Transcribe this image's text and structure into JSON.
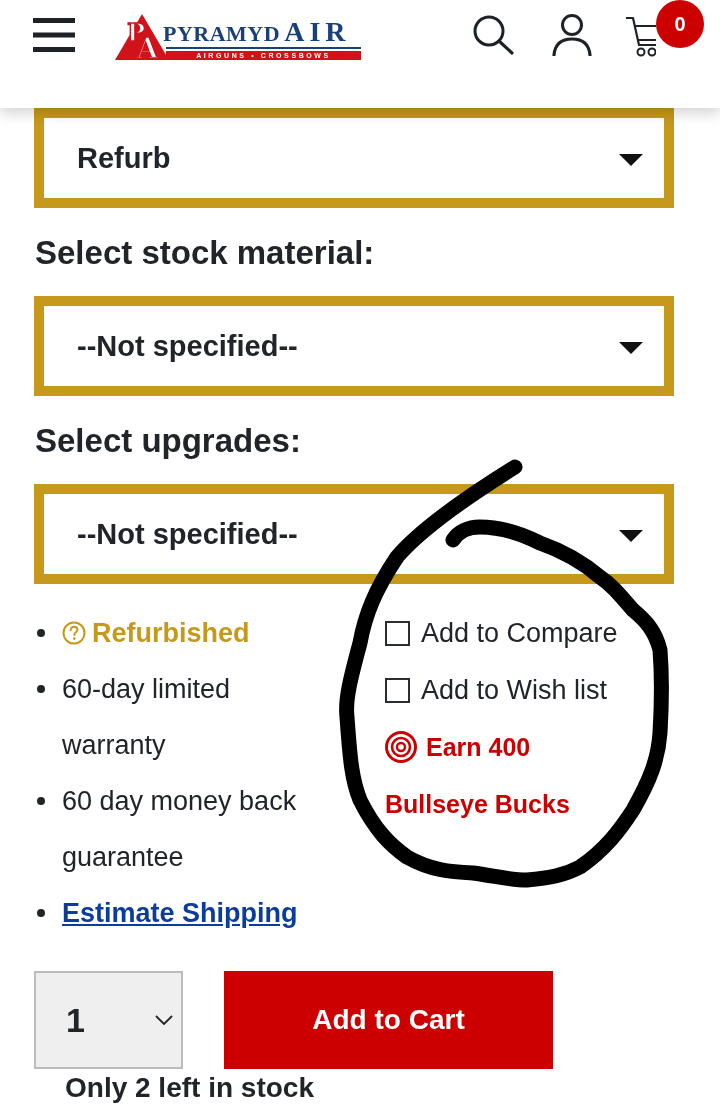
{
  "header": {
    "logo": {
      "monogram": [
        "P",
        "A"
      ],
      "wordmark": [
        "PYRAMYD",
        "AIR"
      ],
      "tagline": "AIRGUNS • CROSSBOWS"
    },
    "cart_count": "0"
  },
  "options": [
    {
      "value": "Refurb"
    },
    {
      "label": "Select stock material:",
      "value": "--Not specified--"
    },
    {
      "label": "Select upgrades:",
      "value": "--Not specified--"
    }
  ],
  "features": [
    {
      "kind": "badge",
      "text": "Refurbished"
    },
    {
      "kind": "text",
      "text": "60-day limited warranty"
    },
    {
      "kind": "text",
      "text": "60 day money back guarantee"
    },
    {
      "kind": "link",
      "text": "Estimate Shipping"
    }
  ],
  "actions": [
    {
      "kind": "checkbox",
      "label": "Add to Compare",
      "checked": false
    },
    {
      "kind": "checkbox",
      "label": "Add to Wish list",
      "checked": false
    },
    {
      "kind": "reward",
      "label": "Earn 400",
      "unit": "Bullseye Bucks"
    }
  ],
  "purchase": {
    "quantity": "1",
    "button": "Add to Cart",
    "stock_note": "Only 2 left in stock"
  },
  "annotation": {
    "kind": "freehand_loop"
  }
}
